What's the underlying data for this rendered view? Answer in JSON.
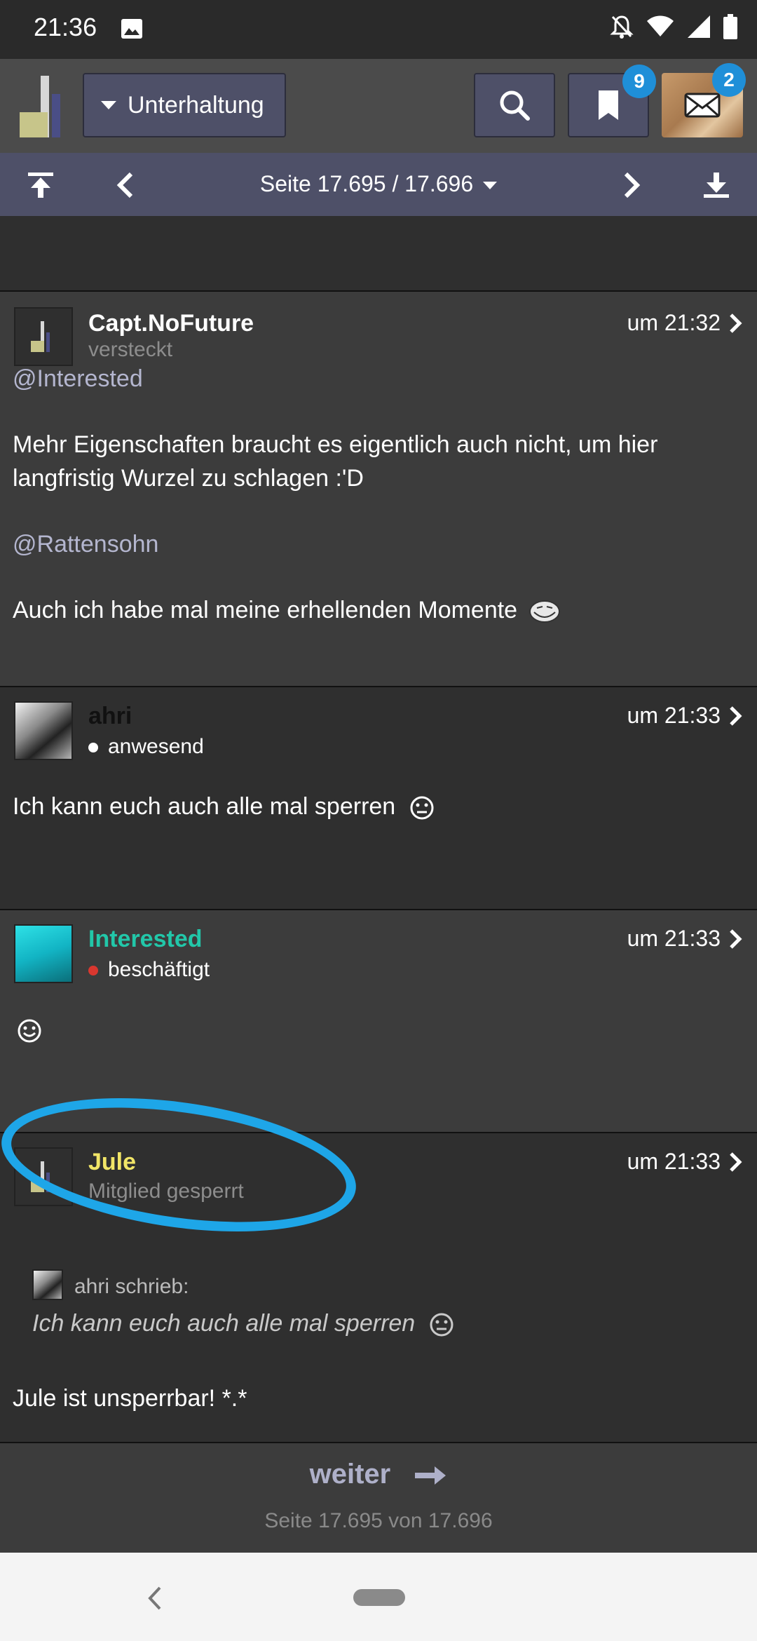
{
  "status_bar": {
    "time": "21:36",
    "icons": [
      "image-icon",
      "notifications-off-icon",
      "wifi-icon",
      "signal-icon",
      "battery-icon"
    ]
  },
  "header": {
    "forum_select": "Unterhaltung",
    "bookmark_badge": "9",
    "mail_badge": "2"
  },
  "pager": {
    "label": "Seite 17.695 / 17.696"
  },
  "posts": [
    {
      "author": "Capt.NoFuture",
      "status": "versteckt",
      "time": "um 21:32",
      "lines": [
        "@Interested",
        "Mehr Eigenschaften braucht es eigentlich auch nicht, um hier langfristig Wurzel zu schlagen :'D",
        "@Rattensohn",
        "Auch ich habe mal meine erhellenden Momente"
      ]
    },
    {
      "author": "ahri",
      "status": "anwesend",
      "time": "um 21:33",
      "text": "Ich kann euch auch alle mal sperren"
    },
    {
      "author": "Interested",
      "status": "beschäftigt",
      "time": "um 21:33"
    },
    {
      "author": "Jule",
      "status": "Mitglied gesperrt",
      "time": "um 21:33",
      "quote_author": "ahri schrieb:",
      "quote_text": "Ich kann euch auch alle mal sperren",
      "text": "Jule ist unsperrbar! *.*"
    }
  ],
  "footer": {
    "next": "weiter",
    "page_info": "Seite 17.695 von 17.696"
  },
  "colors": {
    "accent_pager": "#4e5068",
    "badge": "#1f8fd8",
    "interested_name": "#22c7a9",
    "jule_name": "#f1e567",
    "busy_dot": "#d9372f",
    "annotation": "#1ea6e8"
  }
}
